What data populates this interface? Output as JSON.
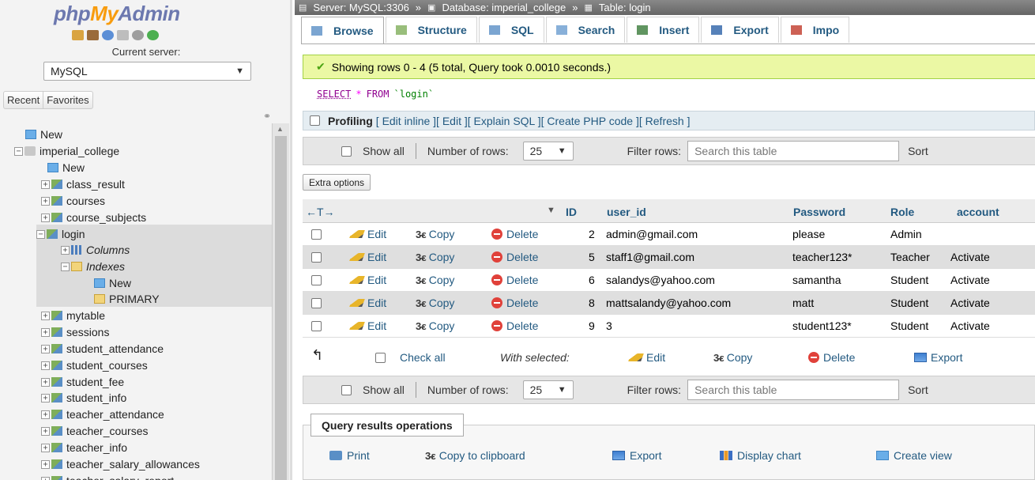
{
  "nav": {
    "logo_php": "php",
    "logo_my": "My",
    "logo_admin": "Admin",
    "current_server_label": "Current server:",
    "server_value": "MySQL",
    "recent": "Recent",
    "favorites": "Favorites",
    "tree": [
      {
        "label": "New",
        "level": 0,
        "icon": "new"
      },
      {
        "label": "imperial_college",
        "level": 0,
        "icon": "db",
        "exp": "−"
      },
      {
        "label": "New",
        "level": 1,
        "icon": "new"
      },
      {
        "label": "class_result",
        "level": 1,
        "icon": "tbl",
        "exp": "+"
      },
      {
        "label": "courses",
        "level": 1,
        "icon": "tbl",
        "exp": "+"
      },
      {
        "label": "course_subjects",
        "level": 1,
        "icon": "tbl",
        "exp": "+"
      },
      {
        "label": "login",
        "level": 1,
        "icon": "tbl",
        "exp": "−",
        "selected": true
      },
      {
        "label": "Columns",
        "level": 2,
        "icon": "col",
        "exp": "+",
        "italic": true,
        "selected": true
      },
      {
        "label": "Indexes",
        "level": 2,
        "icon": "idx",
        "exp": "−",
        "italic": true,
        "selected": true
      },
      {
        "label": "New",
        "level": 3,
        "icon": "new",
        "selected": true
      },
      {
        "label": "PRIMARY",
        "level": 3,
        "icon": "idx",
        "selected": true
      },
      {
        "label": "mytable",
        "level": 1,
        "icon": "tbl",
        "exp": "+"
      },
      {
        "label": "sessions",
        "level": 1,
        "icon": "tbl",
        "exp": "+"
      },
      {
        "label": "student_attendance",
        "level": 1,
        "icon": "tbl",
        "exp": "+"
      },
      {
        "label": "student_courses",
        "level": 1,
        "icon": "tbl",
        "exp": "+"
      },
      {
        "label": "student_fee",
        "level": 1,
        "icon": "tbl",
        "exp": "+"
      },
      {
        "label": "student_info",
        "level": 1,
        "icon": "tbl",
        "exp": "+"
      },
      {
        "label": "teacher_attendance",
        "level": 1,
        "icon": "tbl",
        "exp": "+"
      },
      {
        "label": "teacher_courses",
        "level": 1,
        "icon": "tbl",
        "exp": "+"
      },
      {
        "label": "teacher_info",
        "level": 1,
        "icon": "tbl",
        "exp": "+"
      },
      {
        "label": "teacher_salary_allowances",
        "level": 1,
        "icon": "tbl",
        "exp": "+"
      },
      {
        "label": "teacher_salary_report",
        "level": 1,
        "icon": "tbl",
        "exp": "+"
      }
    ]
  },
  "breadcrumb": {
    "server": "Server: MySQL:3306",
    "database": "Database: imperial_college",
    "table": "Table: login",
    "sep": "»"
  },
  "tabs": [
    {
      "label": "Browse",
      "icon": "browse-icon",
      "active": true
    },
    {
      "label": "Structure",
      "icon": "structure-icon"
    },
    {
      "label": "SQL",
      "icon": "sql-icon"
    },
    {
      "label": "Search",
      "icon": "search-icon"
    },
    {
      "label": "Insert",
      "icon": "insert-icon"
    },
    {
      "label": "Export",
      "icon": "export-icon"
    },
    {
      "label": "Impo",
      "icon": "import-icon"
    }
  ],
  "success_message": "Showing rows 0 - 4 (5 total, Query took 0.0010 seconds.)",
  "sql": {
    "select": "SELECT",
    "star": "*",
    "from": "FROM",
    "table": "`login`"
  },
  "profiling": {
    "label": "Profiling",
    "links": [
      "Edit inline",
      "Edit",
      "Explain SQL",
      "Create PHP code",
      "Refresh"
    ]
  },
  "navbar": {
    "show_all": "Show all",
    "number_of_rows": "Number of rows:",
    "rows_value": "25",
    "filter_rows": "Filter rows:",
    "search_placeholder": "Search this table",
    "sort": "Sort"
  },
  "extra_options": "Extra options",
  "table": {
    "columns": {
      "id": "ID",
      "user_id": "user_id",
      "password": "Password",
      "role": "Role",
      "account": "account"
    },
    "actions": {
      "edit": "Edit",
      "copy": "Copy",
      "delete": "Delete"
    },
    "rows": [
      {
        "id": "2",
        "user_id": "admin@gmail.com",
        "password": "please",
        "role": "Admin",
        "account": ""
      },
      {
        "id": "5",
        "user_id": "staff1@gmail.com",
        "password": "teacher123*",
        "role": "Teacher",
        "account": "Activate"
      },
      {
        "id": "6",
        "user_id": "salandys@yahoo.com",
        "password": "samantha",
        "role": "Student",
        "account": "Activate"
      },
      {
        "id": "8",
        "user_id": "mattsalandy@yahoo.com",
        "password": "matt",
        "role": "Student",
        "account": "Activate"
      },
      {
        "id": "9",
        "user_id": "3",
        "password": "student123*",
        "role": "Student",
        "account": "Activate"
      }
    ]
  },
  "with_selected": {
    "check_all": "Check all",
    "label": "With selected:",
    "edit": "Edit",
    "copy": "Copy",
    "delete": "Delete",
    "export": "Export"
  },
  "query_ops": {
    "legend": "Query results operations",
    "print": "Print",
    "copy_clipboard": "Copy to clipboard",
    "export": "Export",
    "display_chart": "Display chart",
    "create_view": "Create view"
  }
}
